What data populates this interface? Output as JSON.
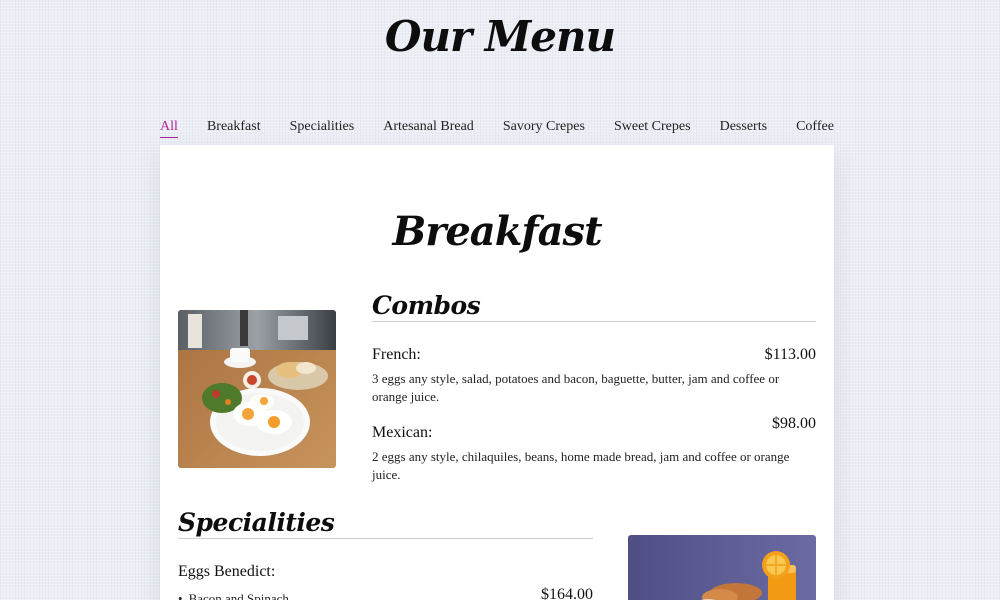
{
  "header": {
    "title": "Our Menu"
  },
  "tabs": [
    {
      "label": "All",
      "active": true
    },
    {
      "label": "Breakfast",
      "active": false
    },
    {
      "label": "Specialities",
      "active": false
    },
    {
      "label": "Artesanal Bread",
      "active": false
    },
    {
      "label": "Savory Crepes",
      "active": false
    },
    {
      "label": "Sweet Crepes",
      "active": false
    },
    {
      "label": "Desserts",
      "active": false
    },
    {
      "label": "Coffee",
      "active": false
    }
  ],
  "colors": {
    "accent": "#b0259a",
    "background": "#eceef5",
    "card": "#ffffff"
  },
  "section": {
    "title": "Breakfast",
    "combos": {
      "title": "Combos",
      "items": [
        {
          "name": "French:",
          "price": "$113.00",
          "description": "3 eggs any style, salad, potatoes and bacon, baguette, butter, jam and coffee or orange juice."
        },
        {
          "name": "Mexican:",
          "price": "$98.00",
          "description": "2 eggs any style, chilaquiles, beans, home made bread, jam and coffee or orange juice."
        }
      ]
    },
    "specialities": {
      "title": "Specialities",
      "items": [
        {
          "name": "Eggs Benedict:",
          "options": [
            {
              "label": "Bacon and Spinach",
              "price": "$164.00"
            }
          ]
        }
      ]
    }
  },
  "images": {
    "breakfast_photo": "plate-eggs-salad-coffee-photo",
    "specialities_photo": "orange-juice-croissants-photo"
  }
}
